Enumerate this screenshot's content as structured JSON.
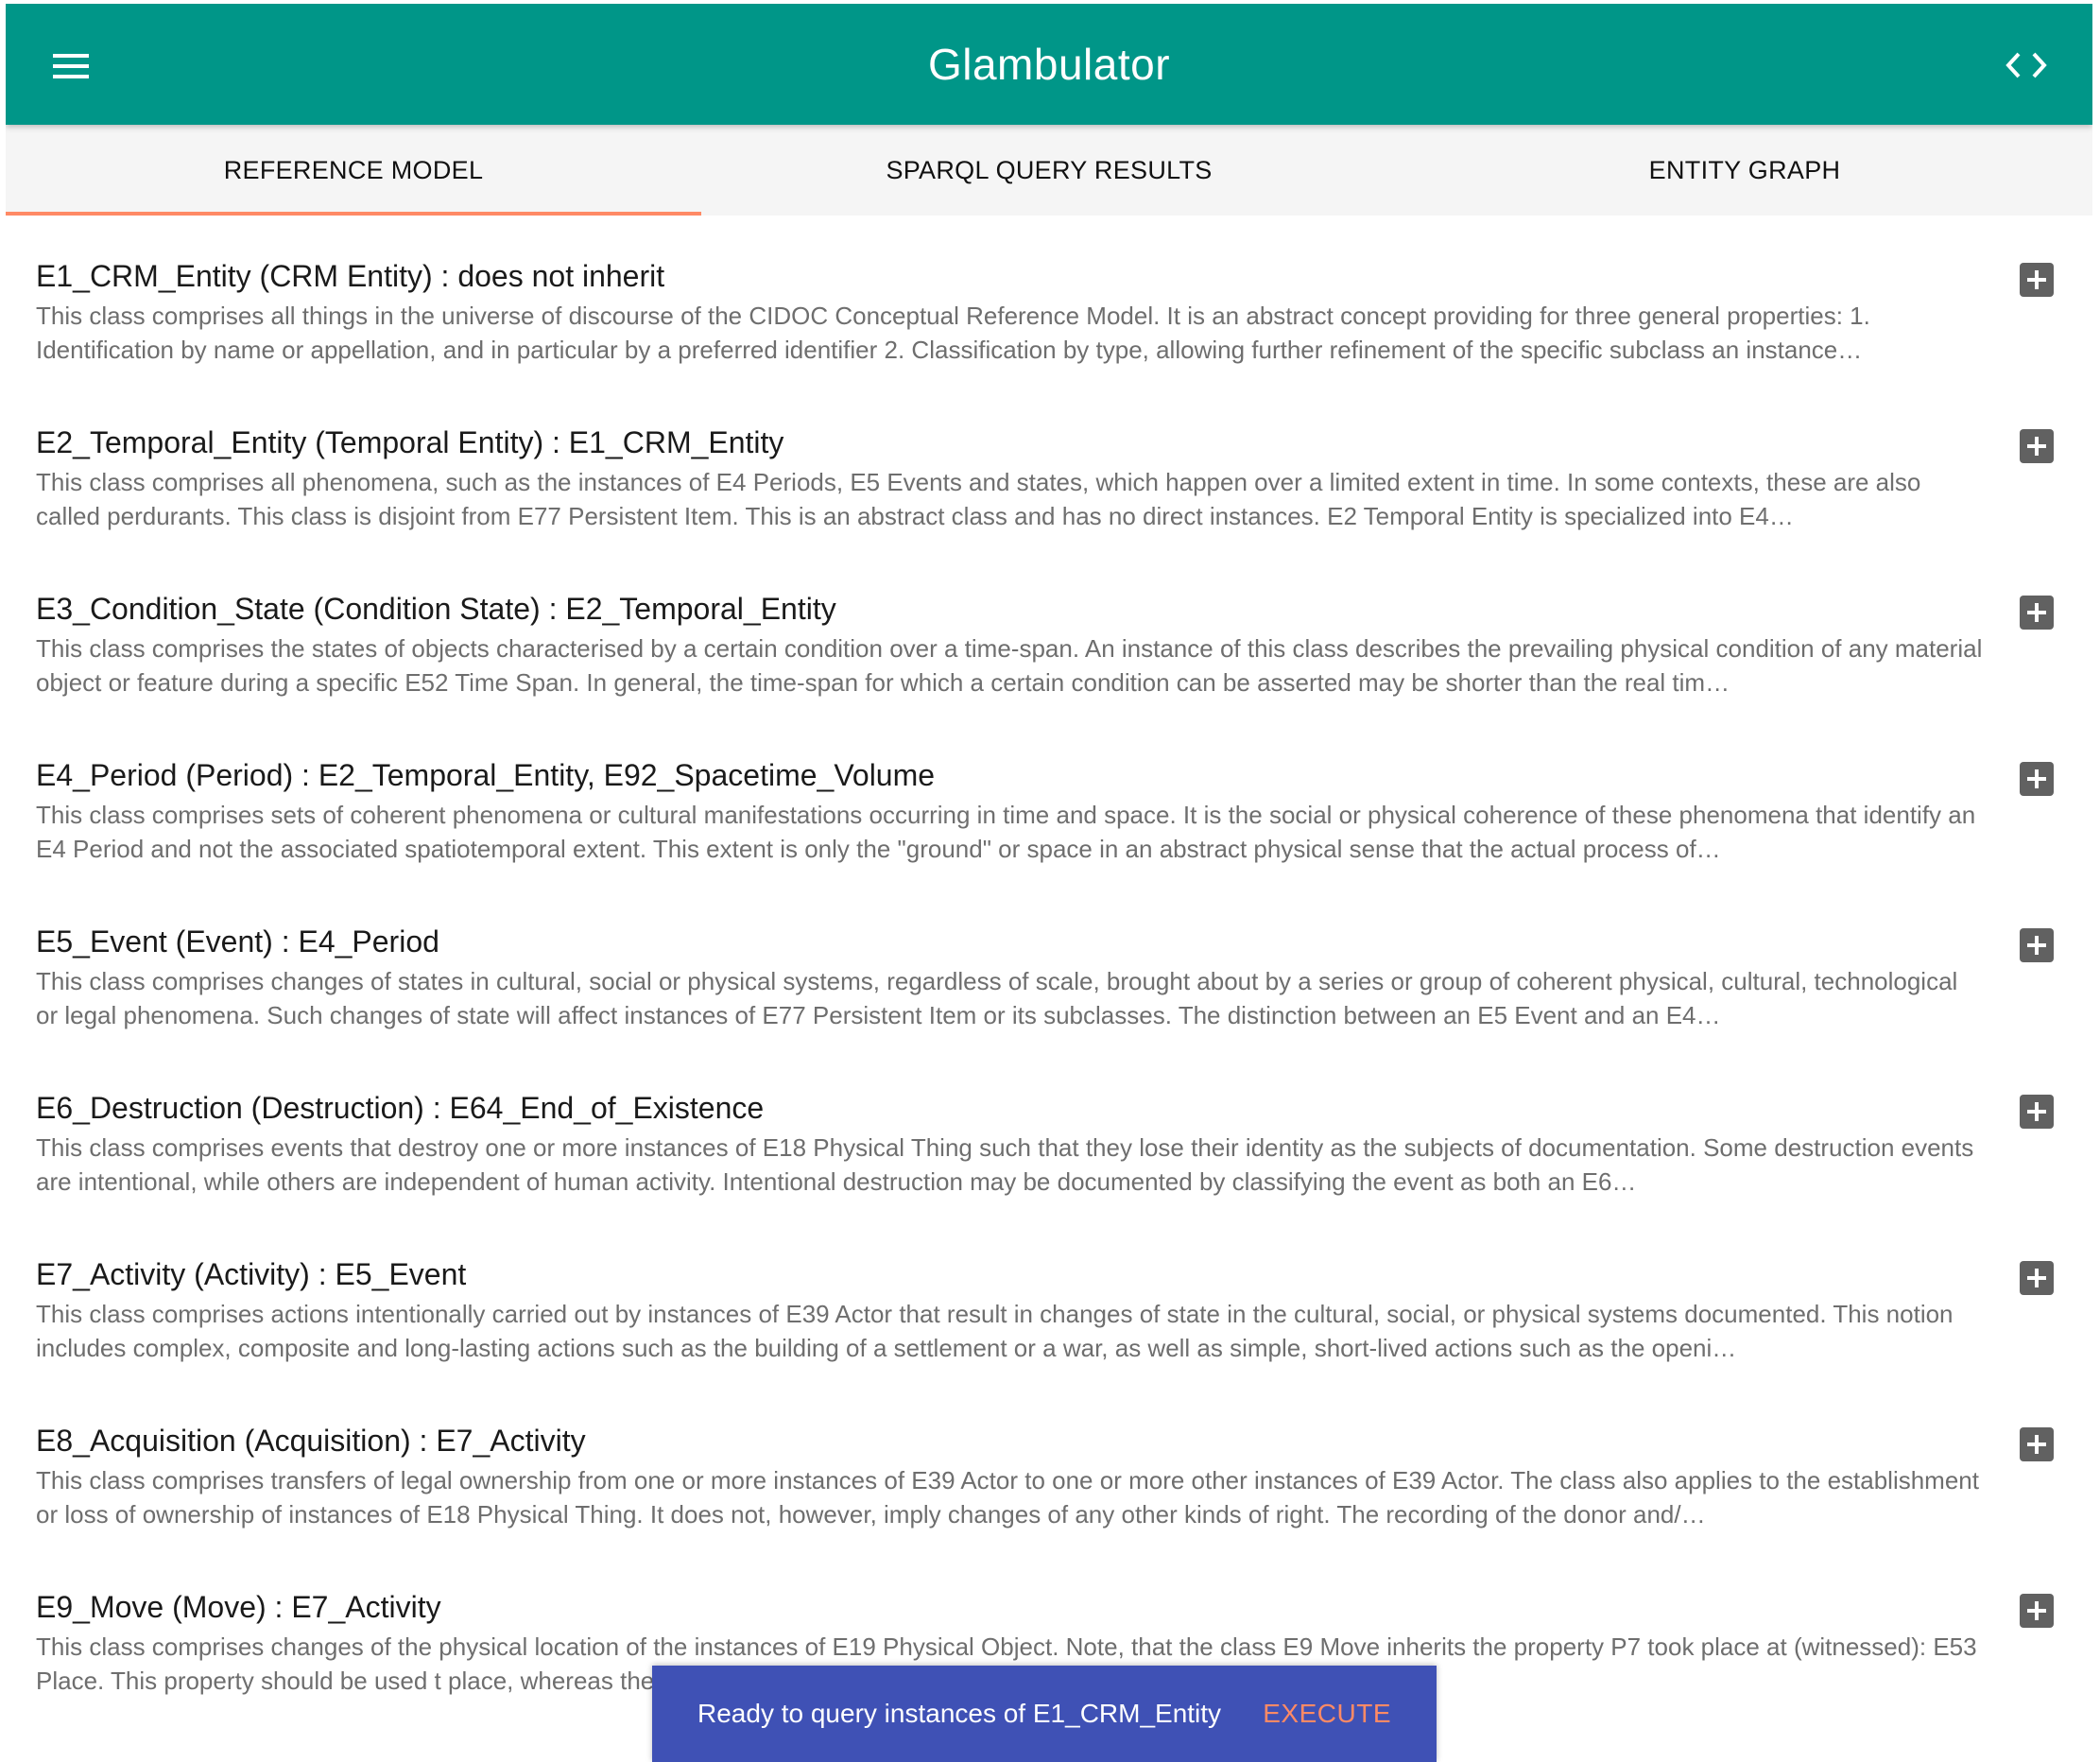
{
  "app": {
    "title": "Glambulator",
    "menu_icon": "menu-icon",
    "code_icon": "code-icon",
    "primary_color": "#009688",
    "accent_color": "#ff8a65"
  },
  "tabs": [
    {
      "label": "REFERENCE MODEL",
      "active": true
    },
    {
      "label": "SPARQL QUERY RESULTS",
      "active": false
    },
    {
      "label": "ENTITY GRAPH",
      "active": false
    }
  ],
  "entities": [
    {
      "title": "E1_CRM_Entity (CRM Entity) : does not inherit",
      "description": "This class comprises all things in the universe of discourse of the CIDOC Conceptual Reference Model. It is an abstract concept providing for three general properties: 1. Identification by name or appellation, and in particular by a preferred identifier 2. Classification by type, allowing further refinement of the specific subclass an instance…"
    },
    {
      "title": "E2_Temporal_Entity (Temporal Entity) : E1_CRM_Entity",
      "description": "This class comprises all phenomena, such as the instances of E4 Periods, E5 Events and states, which happen over a limited extent in time. In some contexts, these are also called perdurants. This class is disjoint from E77 Persistent Item. This is an abstract class and has no direct instances. E2 Temporal Entity is specialized into E4…"
    },
    {
      "title": "E3_Condition_State (Condition State) : E2_Temporal_Entity",
      "description": "This class comprises the states of objects characterised by a certain condition over a time-span. An instance of this class describes the prevailing physical condition of any material object or feature during a specific E52 Time Span. In general, the time-span for which a certain condition can be asserted may be shorter than the real tim…"
    },
    {
      "title": "E4_Period (Period) : E2_Temporal_Entity, E92_Spacetime_Volume",
      "description": "This class comprises sets of coherent phenomena or cultural manifestations occurring in time and space. It is the social or physical coherence of these phenomena that identify an E4 Period and not the associated spatiotemporal extent. This extent is only the \"ground\" or space in an abstract physical sense that the actual process of…"
    },
    {
      "title": "E5_Event (Event) : E4_Period",
      "description": "This class comprises changes of states in cultural, social or physical systems, regardless of scale, brought about by a series or group of coherent physical, cultural, technological or legal phenomena. Such changes of state will affect instances of E77 Persistent Item or its subclasses. The distinction between an E5 Event and an E4…"
    },
    {
      "title": "E6_Destruction (Destruction) : E64_End_of_Existence",
      "description": "This class comprises events that destroy one or more instances of E18 Physical Thing such that they lose their identity as the subjects of documentation. Some destruction events are intentional, while others are independent of human activity. Intentional destruction may be documented by classifying the event as both an E6…"
    },
    {
      "title": "E7_Activity (Activity) : E5_Event",
      "description": "This class comprises actions intentionally carried out by instances of E39 Actor that result in changes of state in the cultural, social, or physical systems documented. This notion includes complex, composite and long-lasting actions such as the building of a settlement or a war, as well as simple, short-lived actions such as the openi…"
    },
    {
      "title": "E8_Acquisition (Acquisition) : E7_Activity",
      "description": "This class comprises transfers of legal ownership from one or more instances of E39 Actor to one or more other instances of E39 Actor. The class also applies to the establishment or loss of ownership of instances of E18 Physical Thing. It does not, however, imply changes of any other kinds of right. The recording of the donor and/…"
    },
    {
      "title": "E9_Move (Move) : E7_Activity",
      "description": "This class comprises changes of the physical location of the instances of E19 Physical Object. Note, that the class E9 Move inherits the property P7 took place at (witnessed): E53 Place. This property should be used t place, whereas the properties P26 moved to…"
    }
  ],
  "add_icon": "plus-icon",
  "snackbar": {
    "message": "Ready to query instances of E1_CRM_Entity",
    "action": "EXECUTE",
    "background": "#3f51b5"
  }
}
